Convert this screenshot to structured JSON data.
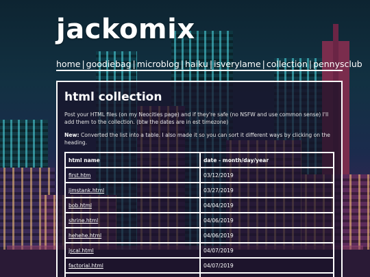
{
  "site": {
    "title": "jackomix"
  },
  "nav": {
    "items": [
      "home",
      "goodiebag",
      "microblog",
      "haiku",
      "isverylame",
      "collection",
      "pennysclub"
    ],
    "separator": "|"
  },
  "main": {
    "heading": "html collection",
    "intro": "Post your HTML files (on my Neocities page) and if they're safe (no NSFW and use common sense) I'll add them to the collection. (btw the dates are in est timezone)",
    "note_label": "New:",
    "note_text": " Converted the list into a table. I also made it so you can sort it different ways by clicking on the heading."
  },
  "table": {
    "headers": [
      "html name",
      "date - month/day/year"
    ],
    "rows": [
      [
        "first.htm",
        "03/12/2019"
      ],
      [
        "jimstank.html",
        "03/27/2019"
      ],
      [
        "bob.html",
        "04/04/2019"
      ],
      [
        "shrine.html",
        "04/06/2019"
      ],
      [
        "hehehe.html",
        "04/06/2019"
      ],
      [
        "jscal.html",
        "04/07/2019"
      ],
      [
        "factorial.html",
        "04/07/2019"
      ],
      [
        "",
        ""
      ]
    ]
  },
  "colors": {
    "text": "#ffffff",
    "panel_bg": "#19122899"
  }
}
